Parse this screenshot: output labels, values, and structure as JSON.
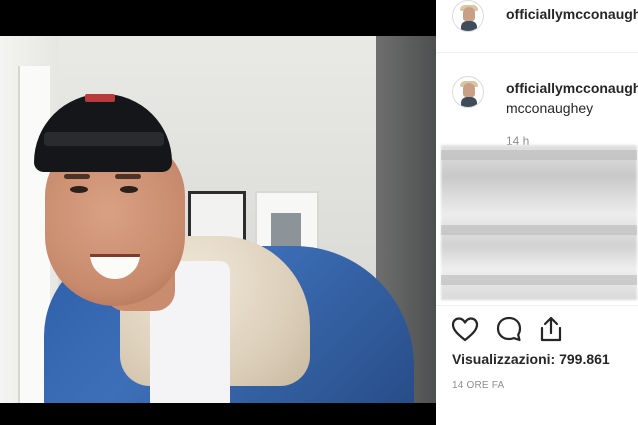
{
  "post": {
    "author_username": "officiallymcconaughey",
    "caption_username": "officiallymcconaughey",
    "caption_text": "mcconaughey",
    "comment_time": "14 h",
    "views_label": "Visualizzazioni: 799.861",
    "posted_ago": "14 ORE FA"
  },
  "actions": {
    "like_icon": "heart-icon",
    "comment_icon": "comment-icon",
    "share_icon": "share-icon"
  },
  "colors": {
    "text_primary": "#262626",
    "text_secondary": "#8e8e8e",
    "divider": "#efefef"
  }
}
